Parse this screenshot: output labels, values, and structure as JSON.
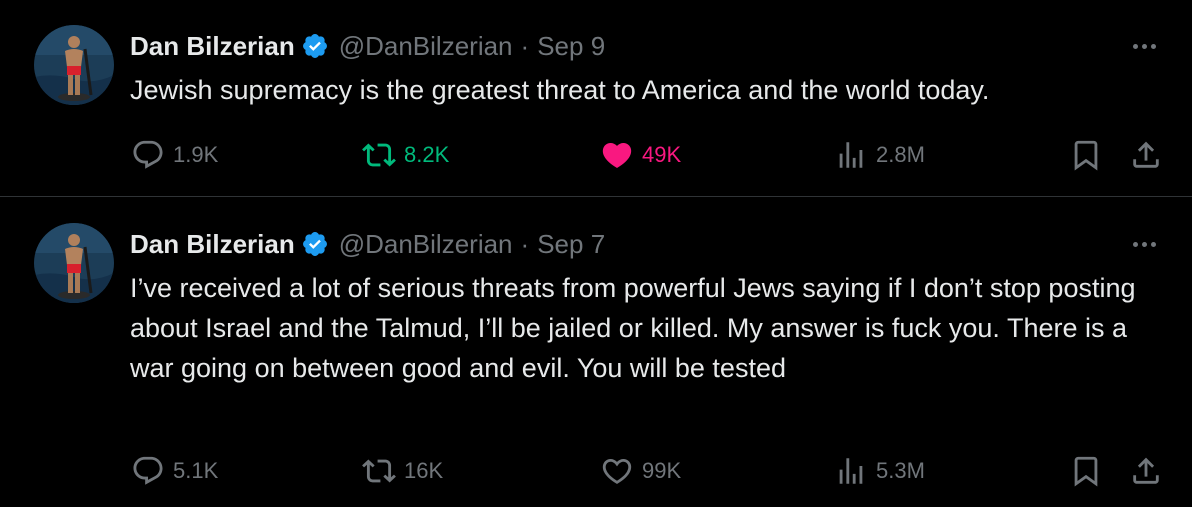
{
  "accent": {
    "retweet": "#00ba7c",
    "like": "#f91880",
    "verified": "#1d9bf0",
    "muted": "#71767b"
  },
  "tweets": [
    {
      "author": {
        "name": "Dan Bilzerian",
        "handle": "@DanBilzerian",
        "verified": true
      },
      "separator": "·",
      "date": "Sep 9",
      "text": "Jewish supremacy is the greatest threat to America and the world today.",
      "stats": {
        "replies": "1.9K",
        "retweets": "8.2K",
        "likes": "49K",
        "views": "2.8M"
      },
      "retweeted": true,
      "liked": true
    },
    {
      "author": {
        "name": "Dan Bilzerian",
        "handle": "@DanBilzerian",
        "verified": true
      },
      "separator": "·",
      "date": "Sep 7",
      "text": "I’ve received a lot of serious threats from powerful Jews saying if I don’t stop posting about Israel and the Talmud, I’ll be jailed or killed. My answer is fuck you. There is a war going on between good and evil. You will be tested",
      "stats": {
        "replies": "5.1K",
        "retweets": "16K",
        "likes": "99K",
        "views": "5.3M"
      },
      "retweeted": false,
      "liked": false
    }
  ],
  "icons": [
    "reply-icon",
    "retweet-icon",
    "like-icon",
    "views-icon",
    "bookmark-icon",
    "share-icon",
    "more-icon",
    "verified-badge-icon"
  ]
}
